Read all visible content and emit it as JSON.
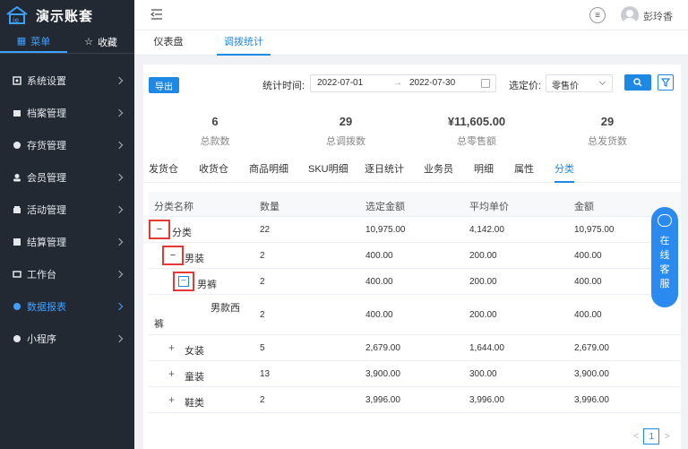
{
  "app": {
    "name": "演示账套"
  },
  "side_tabs": [
    {
      "label": "菜单",
      "icon": "grid-icon",
      "active": true
    },
    {
      "label": "收藏",
      "icon": "star-icon",
      "active": false
    }
  ],
  "menu": [
    {
      "label": "系统设置",
      "icon": "settings-icon"
    },
    {
      "label": "档案管理",
      "icon": "folder-icon"
    },
    {
      "label": "存货管理",
      "icon": "inventory-icon"
    },
    {
      "label": "会员管理",
      "icon": "member-icon"
    },
    {
      "label": "活动管理",
      "icon": "activity-icon"
    },
    {
      "label": "结算管理",
      "icon": "settlement-icon"
    },
    {
      "label": "工作台",
      "icon": "workbench-icon"
    },
    {
      "label": "数据报表",
      "icon": "report-icon",
      "active": true
    },
    {
      "label": "小程序",
      "icon": "miniprogram-icon"
    }
  ],
  "header": {
    "username": "彭玲香"
  },
  "page_tabs": [
    {
      "label": "仪表盘",
      "active": false
    },
    {
      "label": "调拨统计",
      "active": true
    }
  ],
  "toolbar": {
    "export_label": "导出",
    "date_label": "统计时间:",
    "date_start": "2022-07-01",
    "date_arrow": "→",
    "date_end": "2022-07-30",
    "price_label": "选定价:",
    "price_value": "零售价"
  },
  "stats": [
    {
      "value": "6",
      "label": "总款数"
    },
    {
      "value": "29",
      "label": "总调拨数"
    },
    {
      "value": "¥11,605.00",
      "label": "总零售额"
    },
    {
      "value": "29",
      "label": "总发货数"
    }
  ],
  "sub_tabs": [
    "发货仓",
    "收货仓",
    "商品明细",
    "SKU明细",
    "逐日统计",
    "业务员",
    "明细",
    "属性",
    "分类"
  ],
  "active_sub_tab": "分类",
  "table": {
    "headers": [
      "分类名称",
      "数量",
      "选定金额",
      "平均单价",
      "金额"
    ],
    "rows": [
      {
        "name": "分类",
        "expander": "−",
        "qty": "22",
        "sel_amount": "10,975.00",
        "avg": "4,142.00",
        "amount": "10,975.00"
      },
      {
        "name": "男装",
        "expander": "−",
        "qty": "2",
        "sel_amount": "400.00",
        "avg": "200.00",
        "amount": "400.00"
      },
      {
        "name": "男裤",
        "expander": "−",
        "qty": "2",
        "sel_amount": "400.00",
        "avg": "200.00",
        "amount": "400.00"
      },
      {
        "name_line1": "男款西",
        "name_line2": "裤",
        "qty": "2",
        "sel_amount": "400.00",
        "avg": "200.00",
        "amount": "400.00"
      },
      {
        "name": "女装",
        "expander": "+",
        "qty": "5",
        "sel_amount": "2,679.00",
        "avg": "1,644.00",
        "amount": "2,679.00"
      },
      {
        "name": "童装",
        "expander": "+",
        "qty": "13",
        "sel_amount": "3,900.00",
        "avg": "300.00",
        "amount": "3,900.00"
      },
      {
        "name": "鞋类",
        "expander": "+",
        "qty": "2",
        "sel_amount": "3,996.00",
        "avg": "3,996.00",
        "amount": "3,996.00"
      }
    ]
  },
  "chat_widget": {
    "chars": [
      "在",
      "线",
      "客",
      "服"
    ]
  },
  "pager": {
    "prev": "<",
    "page": "1",
    "next": ">"
  },
  "colors": {
    "sidebar_bg": "#232933",
    "accent": "#1e88e5",
    "highlight_box": "#e53935"
  }
}
